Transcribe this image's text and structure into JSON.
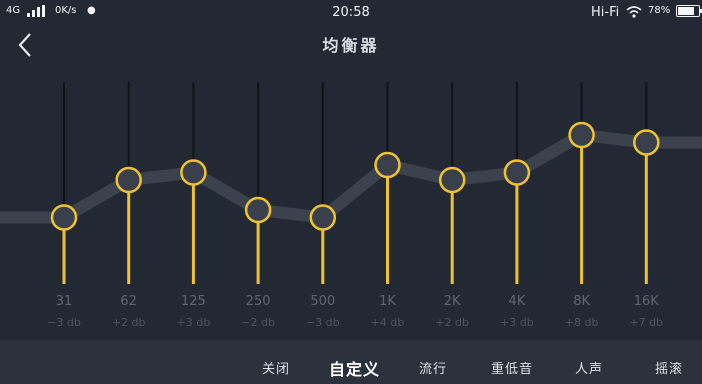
{
  "status_bar": {
    "network": "4G",
    "speed": "0K/s",
    "time": "20:58",
    "hifi": "Hi-Fi",
    "battery": "78%",
    "icons": [
      "signal-icon",
      "flame-icon",
      "wifi-icon",
      "battery-icon"
    ]
  },
  "header": {
    "title": "均衡器",
    "back_icon": "chevron-left-icon"
  },
  "equalizer": {
    "bands": [
      {
        "freq": "31",
        "gain_label": "−3 db",
        "gain": -3
      },
      {
        "freq": "62",
        "gain_label": "+2 db",
        "gain": 2
      },
      {
        "freq": "125",
        "gain_label": "+3 db",
        "gain": 3
      },
      {
        "freq": "250",
        "gain_label": "−2 db",
        "gain": -2
      },
      {
        "freq": "500",
        "gain_label": "−3 db",
        "gain": -3
      },
      {
        "freq": "1K",
        "gain_label": "+4 db",
        "gain": 4
      },
      {
        "freq": "2K",
        "gain_label": "+2 db",
        "gain": 2
      },
      {
        "freq": "4K",
        "gain_label": "+3 db",
        "gain": 3
      },
      {
        "freq": "8K",
        "gain_label": "+8 db",
        "gain": 8
      },
      {
        "freq": "16K",
        "gain_label": "+7 db",
        "gain": 7
      }
    ],
    "colors": {
      "accent": "#f2c12e",
      "track": "#101419",
      "curve": "#3b424d"
    }
  },
  "presets": {
    "items": [
      "关闭",
      "自定义",
      "流行",
      "重低音",
      "人声",
      "摇滚"
    ],
    "selected": "自定义"
  }
}
